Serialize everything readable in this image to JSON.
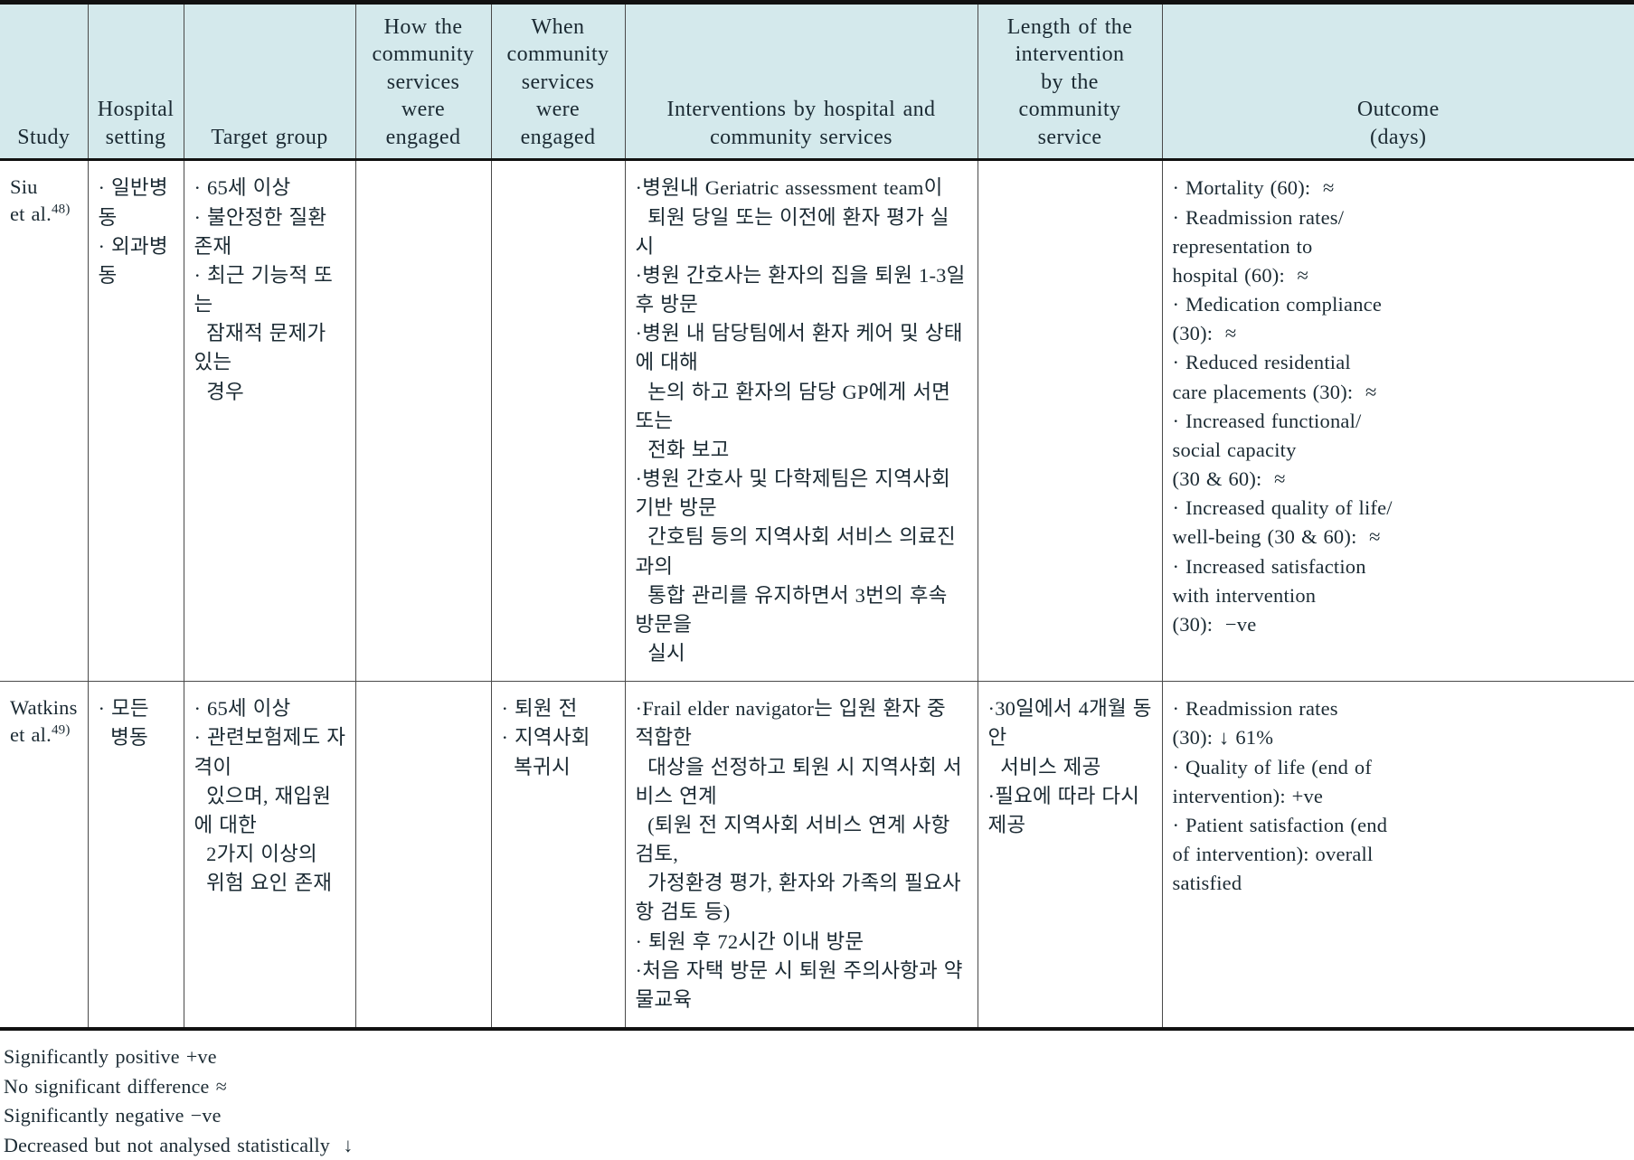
{
  "table": {
    "header_bg": "#d4e9ec",
    "columns": [
      {
        "key": "study",
        "label": "Study"
      },
      {
        "key": "hospital",
        "label": "Hospital\nsetting"
      },
      {
        "key": "target",
        "label": "Target group"
      },
      {
        "key": "how",
        "label": "How the\ncommunity\nservices were\nengaged"
      },
      {
        "key": "when",
        "label": "When\ncommunity\nservices\nwere\nengaged"
      },
      {
        "key": "interventions",
        "label": "Interventions by hospital and\ncommunity services"
      },
      {
        "key": "length",
        "label": "Length of the\nintervention\nby the\ncommunity\nservice"
      },
      {
        "key": "outcome",
        "label": "Outcome\n(days)"
      }
    ],
    "rows": [
      {
        "study": {
          "name": "Siu",
          "second_line": "et al.",
          "superscript": "48)"
        },
        "hospital": [
          "· 일반병동",
          "· 외과병동"
        ],
        "target": [
          "· 65세 이상",
          "· 불안정한 질환 존재",
          "· 최근 기능적 또는",
          "  잠재적 문제가 있는",
          "  경우"
        ],
        "how": [],
        "when": [],
        "interventions": [
          "·병원내 Geriatric assessment team이",
          "  퇴원 당일 또는 이전에 환자 평가 실시",
          "·병원 간호사는 환자의 집을 퇴원 1-3일 후 방문",
          "·병원 내 담당팀에서 환자 케어 및 상태에 대해",
          "  논의 하고 환자의 담당 GP에게 서면 또는",
          "  전화 보고",
          "·병원 간호사 및 다학제팀은 지역사회기반 방문",
          "  간호팀 등의 지역사회 서비스 의료진과의",
          "  통합 관리를 유지하면서 3번의 후속 방문을",
          "  실시"
        ],
        "length": [],
        "outcome": [
          "· Mortality (60):  ≈",
          "· Readmission rates/",
          "representation to",
          "hospital (60):  ≈",
          "· Medication compliance",
          "(30):  ≈",
          "· Reduced residential",
          "care placements (30):  ≈",
          "· Increased functional/",
          "social capacity",
          "(30 & 60):  ≈",
          "· Increased quality of life/",
          "well-being (30 & 60):  ≈",
          "· Increased satisfaction",
          "with intervention",
          "(30):  −ve"
        ]
      },
      {
        "study": {
          "name": "Watkins",
          "second_line": "et al.",
          "superscript": "49)"
        },
        "hospital": [
          "· 모든",
          "  병동"
        ],
        "target": [
          "· 65세 이상",
          "· 관련보험제도 자격이",
          "  있으며, 재입원에 대한",
          "  2가지 이상의",
          "  위험 요인 존재"
        ],
        "how": [],
        "when": [
          "· 퇴원 전",
          "· 지역사회",
          "  복귀시"
        ],
        "interventions": [
          "·Frail elder navigator는 입원 환자 중 적합한",
          "  대상을 선정하고 퇴원 시 지역사회 서비스 연계",
          "  (퇴원 전 지역사회 서비스 연계 사항 검토,",
          "  가정환경 평가, 환자와 가족의 필요사항 검토 등)",
          "· 퇴원 후 72시간 이내 방문",
          "·처음 자택 방문 시 퇴원 주의사항과 약물교육"
        ],
        "length": [
          "·30일에서 4개월 동안",
          "  서비스 제공",
          "·필요에 따라 다시 제공"
        ],
        "outcome": [
          "· Readmission rates",
          "(30): ↓ 61%",
          "· Quality of life (end of",
          "intervention): +ve",
          "· Patient satisfaction (end",
          "of intervention): overall",
          "satisfied"
        ]
      }
    ]
  },
  "legend": {
    "lines": [
      "Significantly positive +ve",
      "No significant difference ≈",
      "Significantly negative −ve",
      "Decreased but not analysed statistically  ↓"
    ]
  }
}
